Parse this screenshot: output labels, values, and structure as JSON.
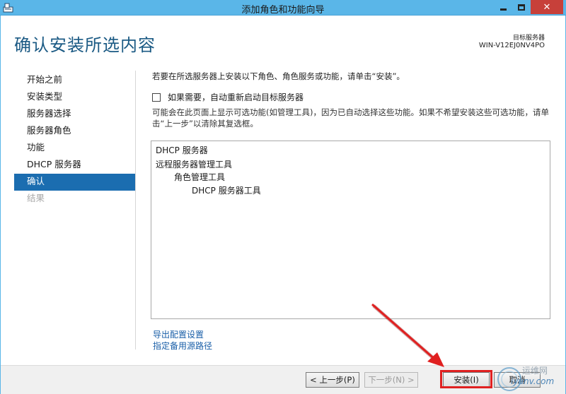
{
  "window": {
    "title": "添加角色和功能向导",
    "close_glyph": "✕"
  },
  "header": {
    "page_title": "确认安装所选内容",
    "target_server_label": "目标服务器",
    "target_server_name": "WIN-V12EJ0NV4PO"
  },
  "nav": {
    "items": [
      {
        "label": "开始之前",
        "state": "normal"
      },
      {
        "label": "安装类型",
        "state": "normal"
      },
      {
        "label": "服务器选择",
        "state": "normal"
      },
      {
        "label": "服务器角色",
        "state": "normal"
      },
      {
        "label": "功能",
        "state": "normal"
      },
      {
        "label": "DHCP 服务器",
        "state": "normal"
      },
      {
        "label": "确认",
        "state": "active"
      },
      {
        "label": "结果",
        "state": "disabled"
      }
    ]
  },
  "main": {
    "intro": "若要在所选服务器上安装以下角色、角色服务或功能，请单击“安装”。",
    "restart_checkbox_label": "如果需要，自动重新启动目标服务器",
    "restart_checked": false,
    "note": "可能会在此页面上显示可选功能(如管理工具)，因为已自动选择这些功能。如果不希望安装这些可选功能，请单击“上一步”以清除其复选框。",
    "selection": [
      "DHCP 服务器",
      "远程服务器管理工具",
      "角色管理工具",
      "DHCP 服务器工具"
    ],
    "export_link": "导出配置设置",
    "alt_source_link": "指定备用源路径"
  },
  "footer": {
    "prev_label": "< 上一步(P)",
    "next_label": "下一步(N) >",
    "install_label": "安装(I)",
    "cancel_label": "取消"
  },
  "watermark": {
    "line1": "运维网",
    "line2": "iyunv.com"
  },
  "colors": {
    "titlebar": "#5ab6e8",
    "accent": "#1b6db0",
    "title_text": "#1b5a84",
    "highlight": "#e02020"
  }
}
